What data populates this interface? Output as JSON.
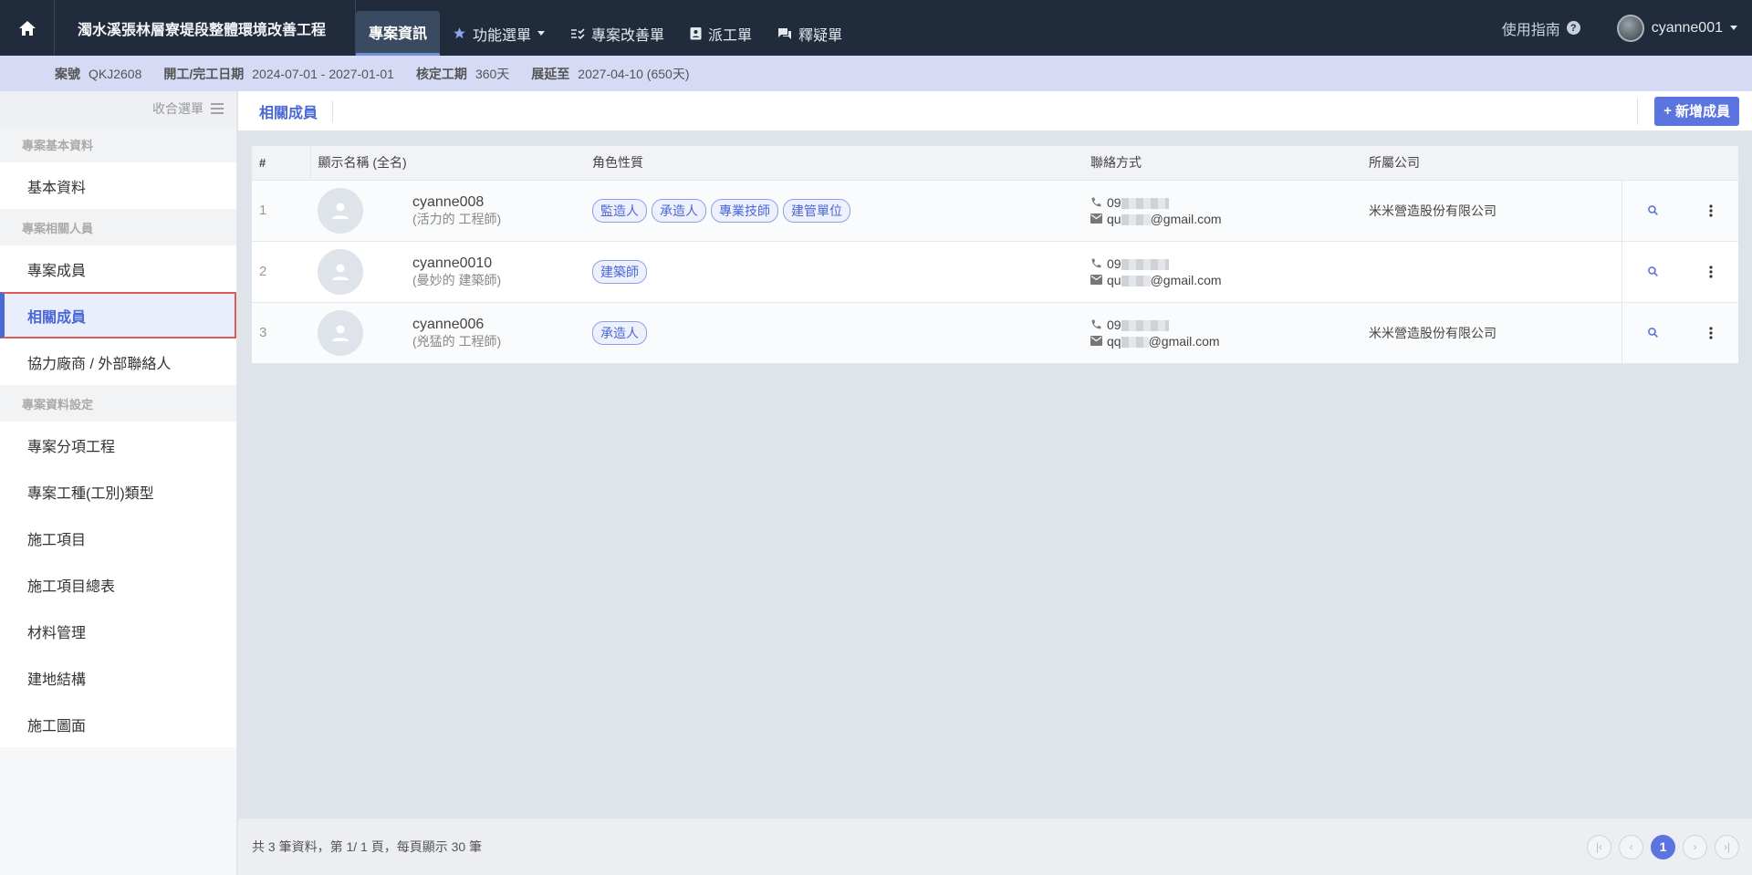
{
  "topbar": {
    "project_title": "濁水溪張林層寮堤段整體環境改善工程",
    "nav": [
      {
        "label": "專案資訊",
        "active": true
      },
      {
        "label": "功能選單"
      },
      {
        "label": "專案改善單"
      },
      {
        "label": "派工單"
      },
      {
        "label": "釋疑單"
      }
    ],
    "guide_label": "使用指南",
    "username": "cyanne001"
  },
  "infobar": {
    "case_no_label": "案號",
    "case_no": "QKJ2608",
    "dates_label": "開工/完工日期",
    "dates": "2024-07-01 - 2027-01-01",
    "period_label": "核定工期",
    "period": "360天",
    "extend_label": "展延至",
    "extend": "2027-04-10 (650天)"
  },
  "sidebar": {
    "collapse_label": "收合選單",
    "groups": [
      {
        "title": "專案基本資料",
        "items": [
          "基本資料"
        ]
      },
      {
        "title": "專案相關人員",
        "items": [
          "專案成員",
          "相關成員",
          "協力廠商 / 外部聯絡人"
        ]
      },
      {
        "title": "專案資料設定",
        "items": [
          "專案分項工程",
          "專案工種(工別)類型",
          "施工項目",
          "施工項目總表",
          "材料管理",
          "建地結構",
          "施工圖面"
        ]
      }
    ],
    "active_item": "相關成員"
  },
  "toolbar": {
    "tab_label": "相關成員",
    "add_label": "新增成員"
  },
  "table": {
    "headers": [
      "#",
      "顯示名稱 (全名)",
      "角色性質",
      "聯絡方式",
      "所屬公司"
    ],
    "rows": [
      {
        "index": "1",
        "name": "cyanne008",
        "fullname": "(活力的 工程師)",
        "roles": [
          "監造人",
          "承造人",
          "專業技師",
          "建管單位"
        ],
        "phone": "09",
        "email_pre": "qu",
        "email_post": "@gmail.com",
        "company": "米米營造股份有限公司"
      },
      {
        "index": "2",
        "name": "cyanne0010",
        "fullname": "(曼妙的 建築師)",
        "roles": [
          "建築師"
        ],
        "phone": "09",
        "email_pre": "qu",
        "email_post": "@gmail.com",
        "company": ""
      },
      {
        "index": "3",
        "name": "cyanne006",
        "fullname": "(兇猛的 工程師)",
        "roles": [
          "承造人"
        ],
        "phone": "09",
        "email_pre": "qq",
        "email_post": "@gmail.com",
        "company": "米米營造股份有限公司"
      }
    ]
  },
  "footer": {
    "summary": "共 3 筆資料，第 1/ 1 頁，每頁顯示 30 筆",
    "current_page": "1"
  },
  "colors": {
    "topbar_bg": "#202b3b",
    "accent": "#5b74e0",
    "infobar_bg": "#d7daf5",
    "highlight_border": "#e05a5a"
  }
}
